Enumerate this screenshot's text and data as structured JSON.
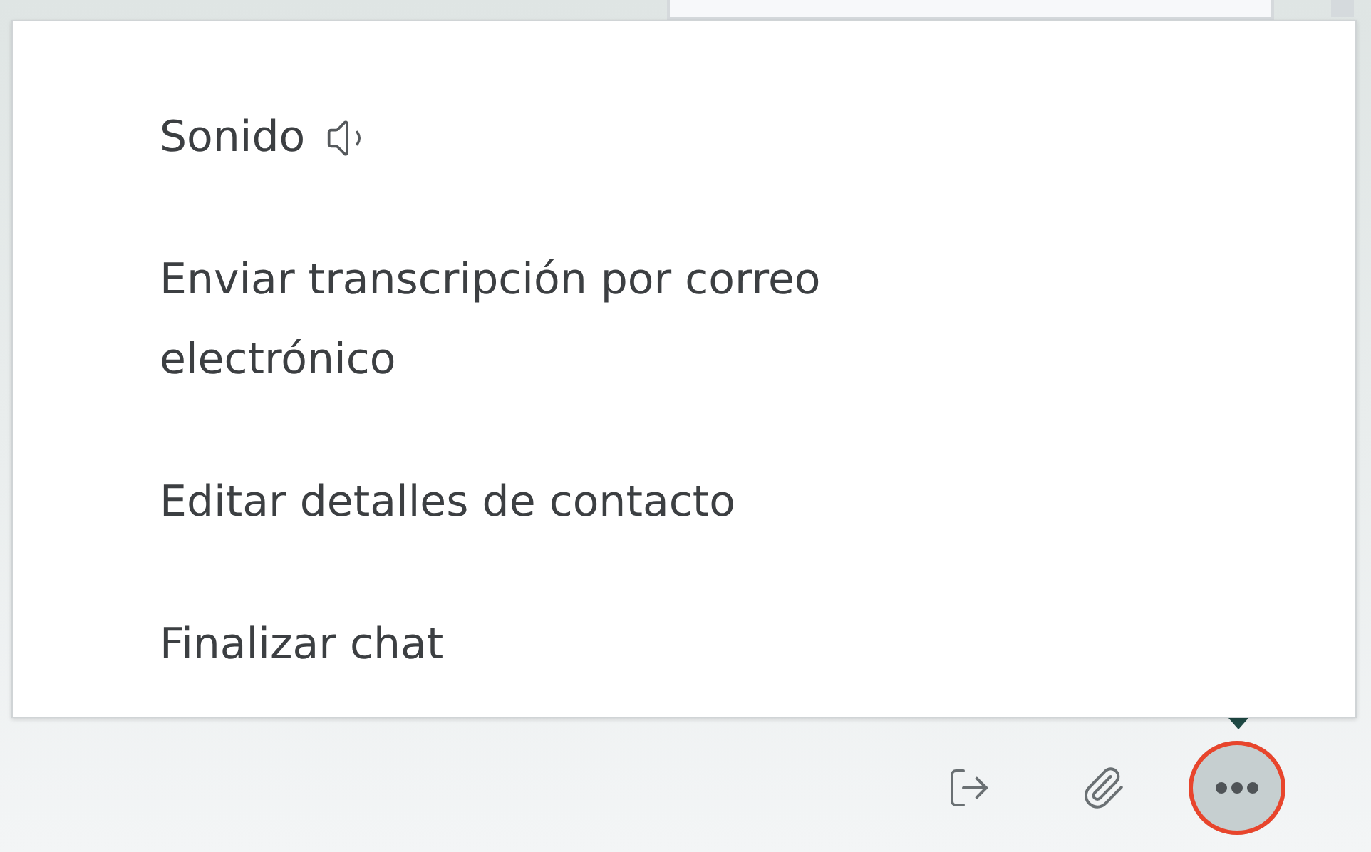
{
  "menu": {
    "items": [
      {
        "label": "Sonido",
        "kind": "sound"
      },
      {
        "label": "Enviar transcripción por correo electrónico",
        "kind": "plain"
      },
      {
        "label": "Editar detalles de contacto",
        "kind": "plain"
      },
      {
        "label": "Finalizar chat",
        "kind": "plain"
      }
    ]
  },
  "toolbar": {
    "buttons": [
      {
        "kind": "leave",
        "selected": false
      },
      {
        "kind": "attach",
        "selected": false
      },
      {
        "kind": "more",
        "selected": true
      }
    ]
  }
}
